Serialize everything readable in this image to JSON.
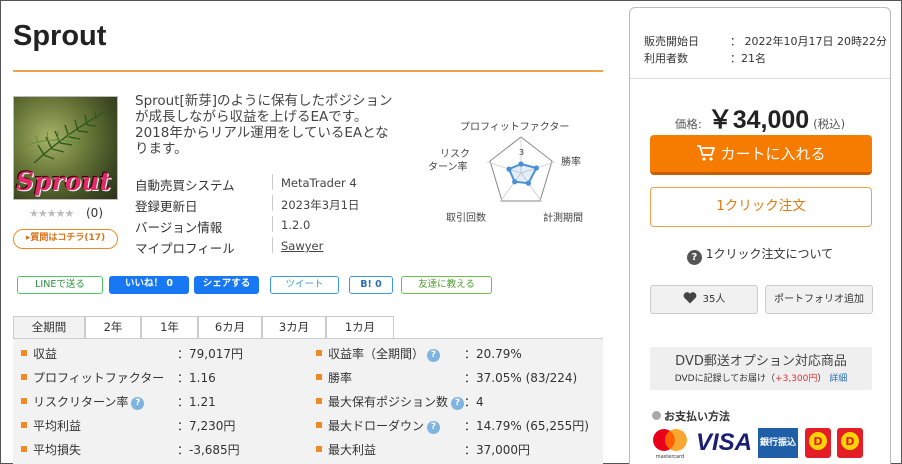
{
  "product": {
    "title": "Sprout",
    "thumbnail_text": "Sprout",
    "rating_stars": "★★★★★",
    "rating_value": 0,
    "rating_count": "(0)",
    "reviews_button": "▸質問はコチラ(17)",
    "description": "Sprout[新芽]のように保有したポジションが成長しながら収益を上げるEAです。2018年からリアル運用をしているEAとなります。",
    "specs": [
      {
        "label": "自動売買システム",
        "value": "MetaTrader 4"
      },
      {
        "label": "登録更新日",
        "value": "2023年3月1日"
      },
      {
        "label": "バージョン情報",
        "value": "1.2.0"
      },
      {
        "label": "マイプロフィール",
        "value": "Sawyer"
      }
    ]
  },
  "radar": {
    "labels": [
      "プロフィットファクター",
      "勝率",
      "計測期間",
      "取引回数",
      "リスク",
      "ターン率"
    ],
    "center_value": "3",
    "values": [
      0.25,
      0.45,
      0.35,
      0.3,
      0.35
    ]
  },
  "share": {
    "line": "LINEで送る",
    "like": "いいね！ 0",
    "fb_share": "シェアする",
    "tweet": "ツイート",
    "hatena": "B! 0",
    "mail": "友達に教える"
  },
  "tabs": [
    "全期間",
    "2年",
    "1年",
    "6カ月",
    "3カ月",
    "1カ月"
  ],
  "stats_left": [
    {
      "label": "収益",
      "value": "：79,017円",
      "help": false
    },
    {
      "label": "プロフィットファクター",
      "value": "：1.16",
      "help": false
    },
    {
      "label": "リスクリターン率",
      "value": "：1.21",
      "help": true
    },
    {
      "label": "平均利益",
      "value": "：7,230円",
      "help": false
    },
    {
      "label": "平均損失",
      "value": "：-3,685円",
      "help": false
    }
  ],
  "stats_right": [
    {
      "label": "収益率（全期間）",
      "value": "：20.79%",
      "help": true
    },
    {
      "label": "勝率",
      "value": "：37.05% (83/224)",
      "help": false
    },
    {
      "label": "最大保有ポジション数",
      "value": "：4",
      "help": true
    },
    {
      "label": "最大ドローダウン",
      "value": "：14.79% (65,255円)",
      "help": true
    },
    {
      "label": "最大利益",
      "value": "：37,000円",
      "help": false
    }
  ],
  "sidebar": {
    "sale_start_label": "販売開始日",
    "sale_start_value": "：  2022年10月17日 20時22分",
    "users_label": "利用者数",
    "users_value": "：21名",
    "price_label": "価格:",
    "price_value": "￥34,000",
    "tax_label": "(税込)",
    "cart_button": "カートに入れる",
    "oneclick_button": "1クリック注文",
    "oneclick_about": "1クリック注文について",
    "favorite_count": "35人",
    "portfolio_button": "ポートフォリオ追加",
    "dvd_title": "DVD郵送オプション対応商品",
    "dvd_sub_a": "DVDに記録してお届け（",
    "dvd_sub_price": "+3,300円",
    "dvd_sub_b": "）",
    "dvd_link": "詳細",
    "payment_title": "お支払い方法",
    "visa": "VISA",
    "bank": "銀行振込"
  },
  "colors": {
    "accent": "#f57c00",
    "title_underline": "#f0a14b",
    "stat_bullet": "#f08a24",
    "radar_line": "#4a90d9"
  }
}
